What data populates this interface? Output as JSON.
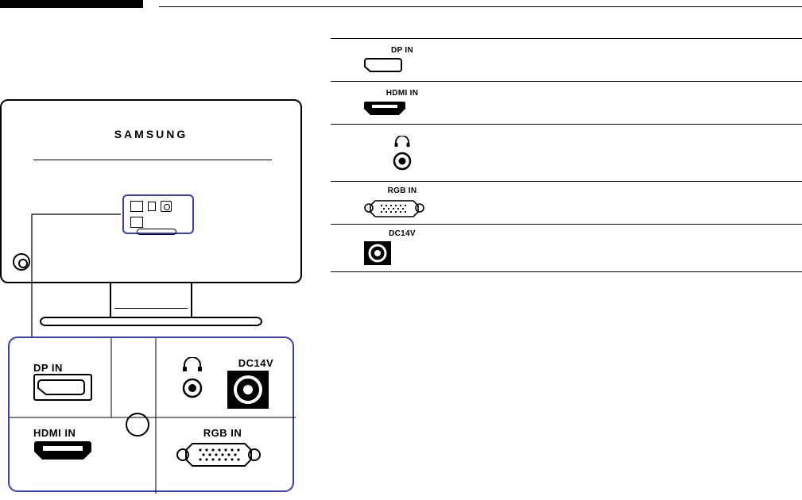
{
  "monitor": {
    "brand": "SAMSUNG"
  },
  "zoom_panel": {
    "dp_label": "DP IN",
    "hdmi_label": "HDMI IN",
    "headphone_label": "",
    "dc_label": "DC14V",
    "rgb_label": "RGB IN"
  },
  "ports": [
    {
      "label": "DP IN",
      "icon": "dp",
      "desc": ""
    },
    {
      "label": "HDMI IN",
      "icon": "hdmi",
      "desc": ""
    },
    {
      "label": "",
      "icon": "hp",
      "desc": ""
    },
    {
      "label": "RGB IN",
      "icon": "vga",
      "desc": ""
    },
    {
      "label": "DC14V",
      "icon": "dc",
      "desc": ""
    }
  ]
}
